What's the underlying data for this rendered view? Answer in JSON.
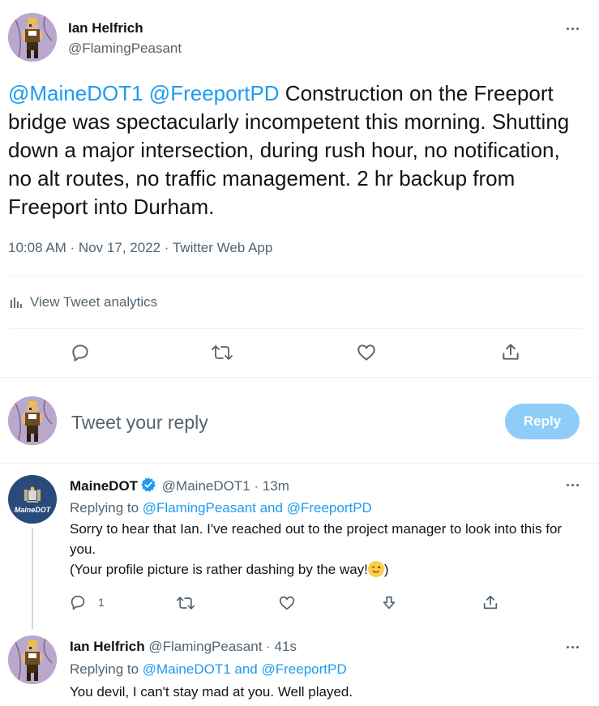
{
  "main_tweet": {
    "author_name": "Ian Helfrich",
    "author_handle": "@FlamingPeasant",
    "mention_1": "@MaineDOT1",
    "mention_2": "@FreeportPD",
    "body": " Construction on the Freeport bridge was spectacularly incompetent this morning. Shutting down a major intersection, during rush hour, no notification, no alt routes, no traffic management. 2 hr backup from Freeport into Durham.",
    "timestamp": "10:08 AM · Nov 17, 2022 · Twitter Web App",
    "analytics_label": "View Tweet analytics"
  },
  "composer": {
    "placeholder": "Tweet your reply",
    "button_label": "Reply"
  },
  "reply_1": {
    "author_name": "MaineDOT",
    "author_handle": "@MaineDOT1",
    "time": " · 13m",
    "avatar_text": "MaineDOT",
    "replying_to_label": "Replying to ",
    "replying_to_users": "@FlamingPeasant and @FreeportPD",
    "line_1": "Sorry to hear that Ian. I've reached out to the project manager to look into this for you.",
    "line_2": "(Your profile picture is rather dashing by the way!",
    "line_2_end": ")",
    "reply_count": "1"
  },
  "reply_2": {
    "author_name": "Ian Helfrich",
    "author_handle": "@FlamingPeasant",
    "time": " · 41s",
    "replying_to_label": "Replying to ",
    "replying_to_users": "@MaineDOT1 and @FreeportPD",
    "text": "You devil, I can't stay mad at you. Well played."
  },
  "colors": {
    "accent": "#1d9bf0",
    "muted": "#536471",
    "divider": "#eff3f4",
    "reply_button_disabled": "#8ecdf8",
    "maine_dot_avatar": "#2a4a7b"
  }
}
